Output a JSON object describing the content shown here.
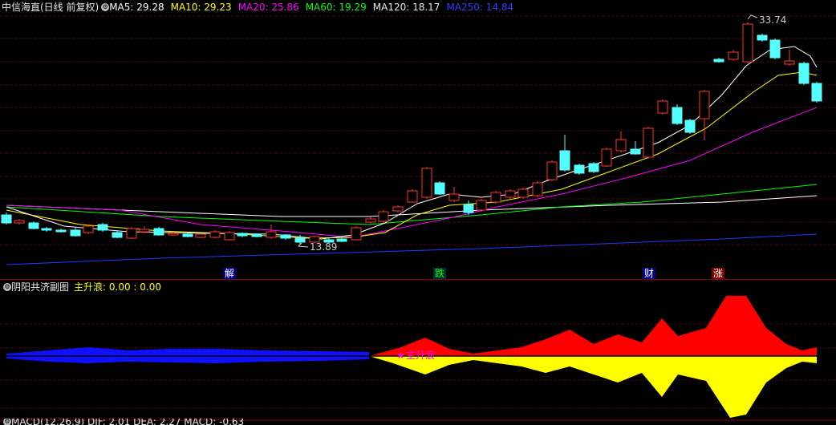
{
  "main_legend": {
    "title": "中信海直(日线 前复权)",
    "ma5": "MA5: 29.28",
    "ma10": "MA10: 29.23",
    "ma20": "MA20: 25.86",
    "ma60": "MA60: 19.29",
    "ma120": "MA120: 18.17",
    "ma250": "MA250: 14.84"
  },
  "main_chart": {
    "high_label": "33.74",
    "low_label": "13.89",
    "ma_colors": {
      "ma5": "#ffffff",
      "ma10": "#ffff00",
      "ma20": "#ff00ff",
      "ma60": "#00ff00",
      "ma120": "#ffffff",
      "ma250": "#1e3cff"
    },
    "up_color": "#ff3232",
    "down_color": "#54ffff"
  },
  "markers": [
    {
      "text": "解",
      "color": "#ffffff",
      "bg": "#000080"
    },
    {
      "text": "跌",
      "color": "#00ff00",
      "bg": "#003030"
    },
    {
      "text": "财",
      "color": "#ffffff",
      "bg": "#000080"
    },
    {
      "text": "涨",
      "color": "#ffffff",
      "bg": "#800000"
    }
  ],
  "sub_legend": {
    "title": "阴阳共济副图",
    "value": "主升浪: 0.00 : 0.00",
    "annotation": "主升浪"
  },
  "bottom_legend": {
    "text": "MACD(12,26,9) DIF: 2.01 DEA: 2.27 MACD: -0.63"
  }
}
